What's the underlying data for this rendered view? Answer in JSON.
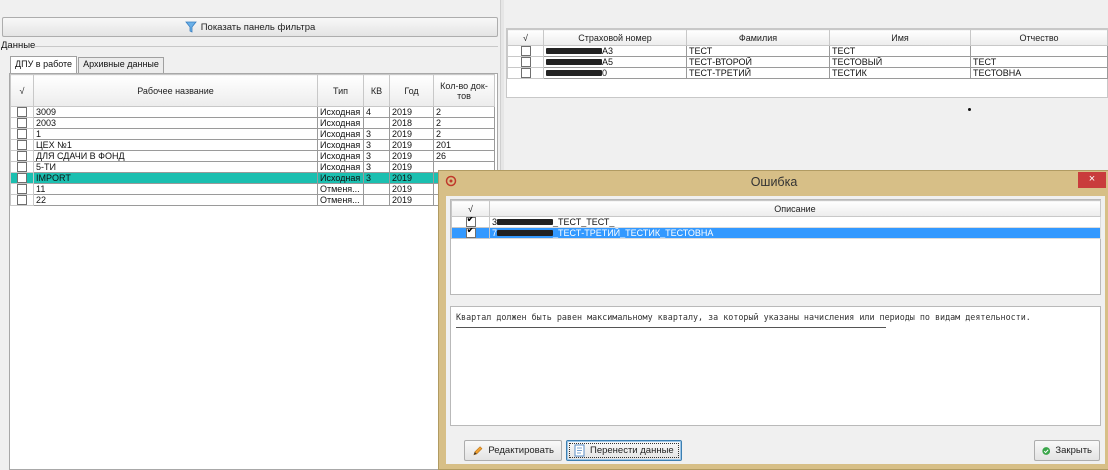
{
  "filter_panel": {
    "label": "Показать панель фильтра"
  },
  "data_group": {
    "label": "Данные"
  },
  "tabs": [
    {
      "label": "ДПУ в работе",
      "active": true
    },
    {
      "label": "Архивные данные",
      "active": false
    }
  ],
  "dpu_table": {
    "columns": [
      "√",
      "Рабочее название",
      "Тип",
      "КВ",
      "Год",
      "Кол-во док-тов"
    ],
    "rows": [
      {
        "name": "3009",
        "type": "Исходная",
        "kv": "4",
        "year": "2019",
        "count": "2",
        "selected": false
      },
      {
        "name": "2003",
        "type": "Исходная",
        "kv": "",
        "year": "2018",
        "count": "2",
        "selected": false
      },
      {
        "name": "1",
        "type": "Исходная",
        "kv": "3",
        "year": "2019",
        "count": "2",
        "selected": false
      },
      {
        "name": "ЦЕХ №1",
        "type": "Исходная",
        "kv": "3",
        "year": "2019",
        "count": "201",
        "selected": false
      },
      {
        "name": "ДЛЯ СДАЧИ В ФОНД",
        "type": "Исходная",
        "kv": "3",
        "year": "2019",
        "count": "26",
        "selected": false
      },
      {
        "name": "5-ТИ",
        "type": "Исходная",
        "kv": "3",
        "year": "2019",
        "count": "",
        "selected": false
      },
      {
        "name": "IMPORT",
        "type": "Исходная",
        "kv": "3",
        "year": "2019",
        "count": "",
        "selected": true
      },
      {
        "name": "11",
        "type": "Отменя...",
        "kv": "",
        "year": "2019",
        "count": "",
        "selected": false
      },
      {
        "name": "22",
        "type": "Отменя...",
        "kv": "",
        "year": "2019",
        "count": "",
        "selected": false
      }
    ]
  },
  "persons_table": {
    "columns": [
      "√",
      "Страховой номер",
      "Фамилия",
      "Имя",
      "Отчество"
    ],
    "rows": [
      {
        "snils_tail": "А3",
        "last_name": "ТЕСТ",
        "first_name": "ТЕСТ",
        "patronymic": ""
      },
      {
        "snils_tail": "А5",
        "last_name": "ТЕСТ-ВТОРОЙ",
        "first_name": "ТЕСТОВЫЙ",
        "patronymic": "ТЕСТ"
      },
      {
        "snils_tail": "0",
        "last_name": "ТЕСТ-ТРЕТИЙ",
        "first_name": "ТЕСТИК",
        "patronymic": "ТЕСТОВНА"
      }
    ]
  },
  "error_dialog": {
    "title": "Ошибка",
    "close_glyph": "×",
    "table": {
      "columns": [
        "√",
        "Описание"
      ],
      "rows": [
        {
          "prefix": "3",
          "text": "_ТЕСТ_ТЕСТ_",
          "checked": true,
          "selected": false
        },
        {
          "prefix": "7",
          "text": "_ТЕСТ-ТРЕТИЙ_ТЕСТИК_ТЕСТОВНА",
          "checked": true,
          "selected": true
        }
      ]
    },
    "message": "Квартал должен быть равен максимальному кварталу, за который указаны начисления или периоды по видам деятельности.",
    "buttons": {
      "edit": "Редактировать",
      "transfer": "Перенести данные",
      "close": "Закрыть"
    }
  },
  "colors": {
    "selected_row": "#1bbfb0",
    "dialog_frame": "#d7bf87",
    "error_selected_row": "#3399ff",
    "close_button": "#c93c3c"
  },
  "icons": [
    "funnel-icon",
    "pencil-icon",
    "document-icon",
    "check-circle-icon",
    "app-icon",
    "close-icon"
  ]
}
